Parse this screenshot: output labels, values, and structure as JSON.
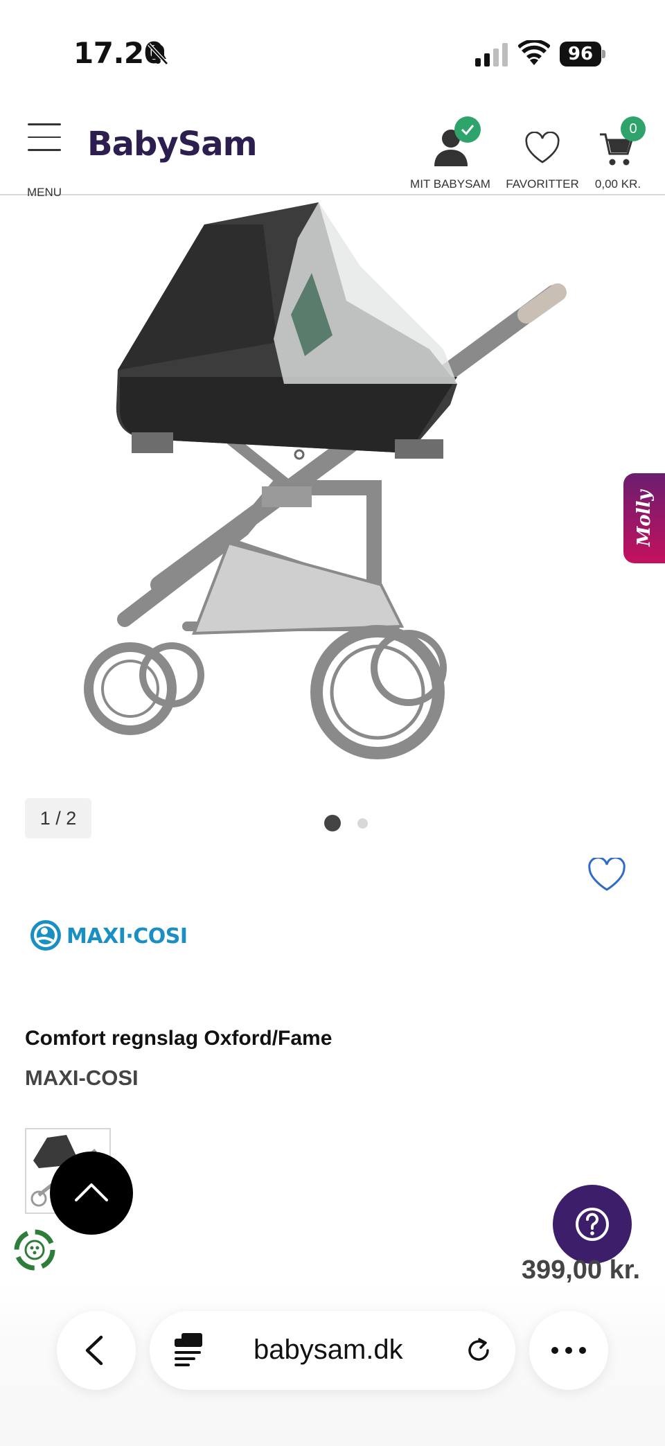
{
  "status_bar": {
    "time": "17.20",
    "battery": "96"
  },
  "header": {
    "menu_label": "MENU",
    "logo": "BabySam",
    "account_label": "MIT BABYSAM",
    "favorites_label": "FAVORITTER",
    "cart_label": "0,00 KR.",
    "cart_count": "0",
    "accent_color": "#2c1e4f",
    "badge_color": "#2ea36b"
  },
  "gallery": {
    "counter": "1 / 2",
    "slides": 2,
    "active_slide": 1
  },
  "chat_tab": {
    "label": "Molly"
  },
  "product": {
    "brand_logo": "MAXI·COSI",
    "title": "Comfort regnslag Oxford/Fame",
    "brand": "MAXI-COSI",
    "price": "399,00 kr."
  },
  "browser": {
    "url": "babysam.dk"
  },
  "icons": {
    "status": [
      "bell-slash-icon",
      "signal-icon",
      "wifi-icon",
      "battery-icon"
    ],
    "header": [
      "hamburger-icon",
      "user-icon",
      "checkmark-icon",
      "heart-icon",
      "cart-icon"
    ],
    "page": [
      "heart-outline-icon",
      "chevron-up-icon",
      "question-mark-icon",
      "recycle-icon"
    ],
    "browser": [
      "chevron-left-icon",
      "reader-icon",
      "reload-icon",
      "ellipsis-icon"
    ]
  }
}
